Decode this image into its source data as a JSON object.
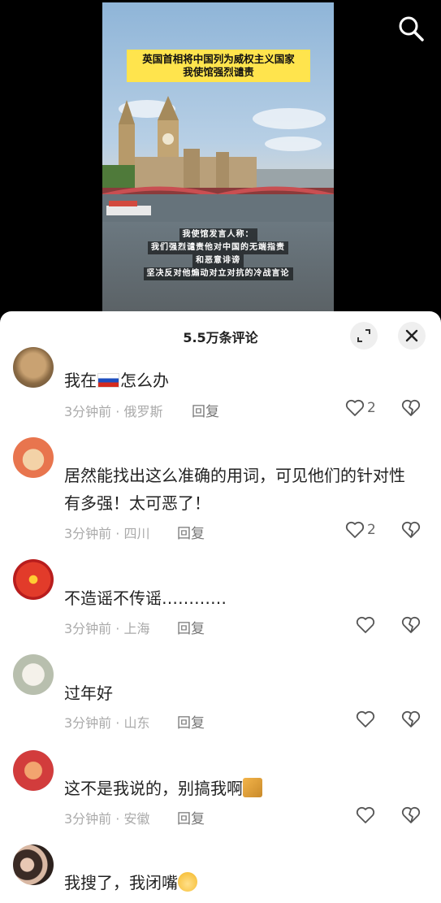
{
  "video": {
    "headline_line1": "英国首相将中国列为威权主义国家",
    "headline_line2": "我使馆强烈谴责",
    "subtitles": [
      "我使馆发言人称：",
      "我们强烈谴责他对中国的无端指责",
      "和恶意诽谤",
      "坚决反对他煽动对立对抗的冷战言论"
    ]
  },
  "sheet": {
    "title": "5.5万条评论",
    "expand_icon": "expand-icon",
    "close_icon": "close-icon"
  },
  "comments": [
    {
      "text_before": "我在",
      "has_flag": true,
      "text_after": "怎么办",
      "meta": "3分钟前 · 俄罗斯",
      "reply": "回复",
      "likes": "2"
    },
    {
      "text_line1": "居然能找出这么准确的用词，可见他们的针对性",
      "text_line2": "有多强！太可恶了！",
      "meta": "3分钟前 · 四川",
      "reply": "回复",
      "likes": "2"
    },
    {
      "text": "不造谣不传谣…………",
      "meta": "3分钟前 · 上海",
      "reply": "回复",
      "likes": ""
    },
    {
      "text": "过年好",
      "meta": "3分钟前 · 山东",
      "reply": "回复",
      "likes": ""
    },
    {
      "text": "这不是我说的，别搞我啊",
      "meta": "3分钟前 · 安徽",
      "reply": "回复",
      "likes": ""
    },
    {
      "text": "我搜了，我闭嘴",
      "meta": "",
      "reply": "",
      "likes": ""
    }
  ],
  "colors": {
    "accent_yellow": "#ffe44d",
    "meta_gray": "#aaaaaa"
  }
}
